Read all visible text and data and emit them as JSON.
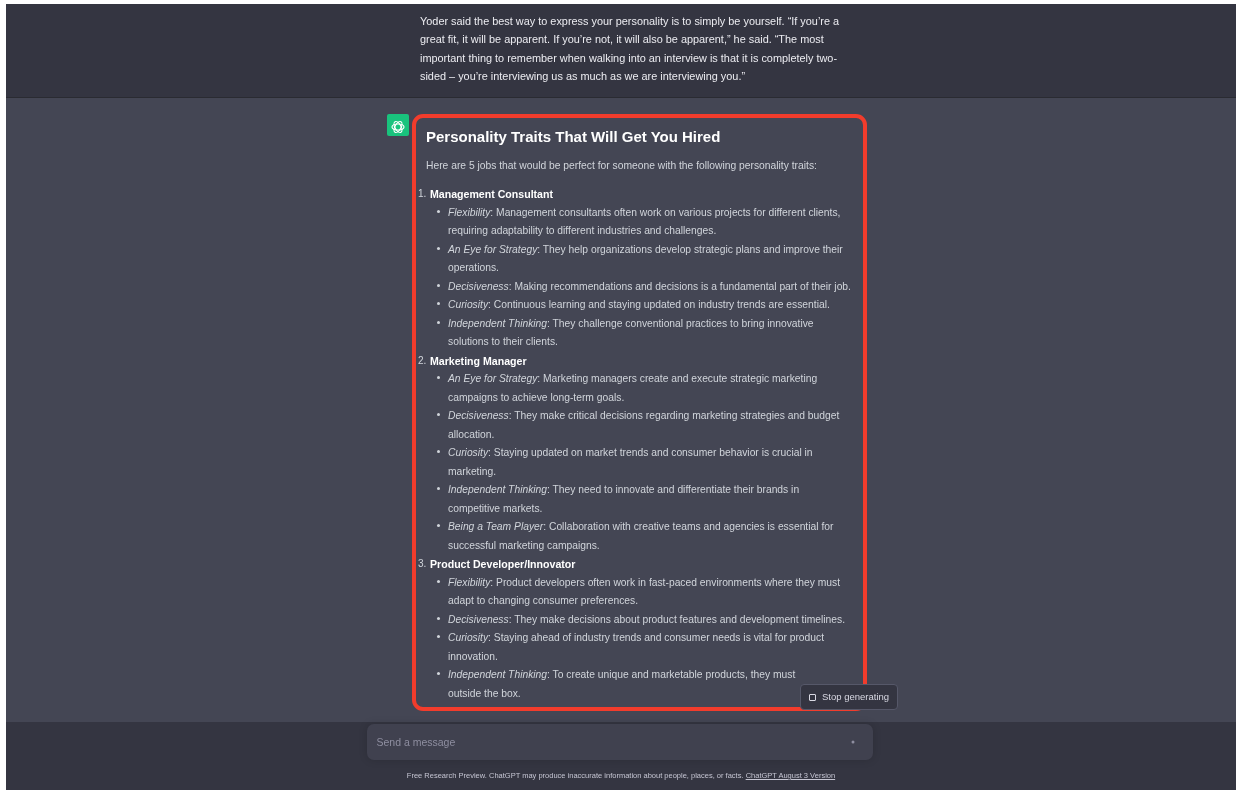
{
  "context_message": {
    "text": "Yoder said the best way to express your personality is to simply be yourself. “If you’re a great fit, it will be apparent. If you’re not, it will also be apparent,” he said. “The most important thing to remember when walking into an interview is that it is completely two-sided – you’re interviewing us as much as we are interviewing you.”"
  },
  "assistant": {
    "title": "Personality Traits That Will Get You Hired",
    "intro": "Here are 5 jobs that would be perfect for someone with the following personality traits:",
    "jobs": [
      {
        "number": "1.",
        "title": "Management Consultant",
        "traits": [
          {
            "text": "*Flexibility*: Management consultants often work on various projects for different clients, requiring adaptability to different industries and challenges."
          },
          {
            "text": "*An Eye for Strategy*: They help organizations develop strategic plans and improve their operations."
          },
          {
            "text": "*Decisiveness*: Making recommendations and decisions is a fundamental part of their job."
          },
          {
            "text": "*Curiosity*: Continuous learning and staying updated on industry trends are essential."
          },
          {
            "text": "*Independent Thinking*: They challenge conventional practices to bring innovative solutions to their clients."
          }
        ]
      },
      {
        "number": "2.",
        "title": "Marketing Manager",
        "traits": [
          {
            "text": "*An Eye for Strategy*: Marketing managers create and execute strategic marketing campaigns to achieve long-term goals."
          },
          {
            "text": "*Decisiveness*: They make critical decisions regarding marketing strategies and budget allocation."
          },
          {
            "text": "*Curiosity*: Staying updated on market trends and consumer behavior is crucial in marketing."
          },
          {
            "text": "*Independent Thinking*: They need to innovate and differentiate their brands in competitive markets."
          },
          {
            "text": "*Being a Team Player*: Collaboration with creative teams and agencies is essential for successful marketing campaigns."
          }
        ]
      },
      {
        "number": "3.",
        "title": "Product Developer/Innovator",
        "traits": [
          {
            "text": "*Flexibility*: Product developers often work in fast-paced environments where they must adapt to changing consumer preferences."
          },
          {
            "text": "*Decisiveness*: They make decisions about product features and development timelines."
          },
          {
            "text": "*Curiosity*: Staying ahead of industry trends and consumer needs is vital for product innovation."
          },
          {
            "lines": [
              "*Independent Thinking*: To create unique and marketable products, they must",
              "outside the box."
            ]
          }
        ]
      }
    ]
  },
  "stop_button": {
    "label": "Stop generating"
  },
  "composer": {
    "placeholder": "Send a message"
  },
  "footer": {
    "text": "Free Research Preview. ChatGPT may produce inaccurate information about people, places, or facts.",
    "link": "ChatGPT August 3 Version"
  }
}
